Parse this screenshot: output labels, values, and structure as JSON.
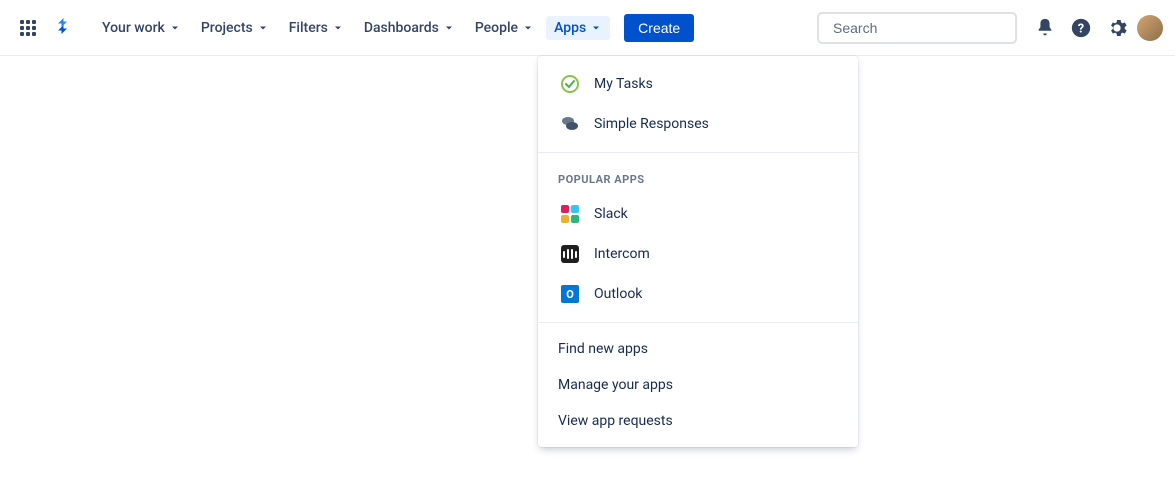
{
  "nav": {
    "items": [
      {
        "label": "Your work"
      },
      {
        "label": "Projects"
      },
      {
        "label": "Filters"
      },
      {
        "label": "Dashboards"
      },
      {
        "label": "People"
      },
      {
        "label": "Apps"
      }
    ],
    "create_label": "Create"
  },
  "search": {
    "placeholder": "Search"
  },
  "dropdown": {
    "your_apps": [
      {
        "label": "My Tasks",
        "icon": "mytasks"
      },
      {
        "label": "Simple Responses",
        "icon": "responses"
      }
    ],
    "popular_heading": "POPULAR APPS",
    "popular_apps": [
      {
        "label": "Slack",
        "icon": "slack"
      },
      {
        "label": "Intercom",
        "icon": "intercom"
      },
      {
        "label": "Outlook",
        "icon": "outlook"
      }
    ],
    "actions": [
      {
        "label": "Find new apps"
      },
      {
        "label": "Manage your apps"
      },
      {
        "label": "View app requests"
      }
    ]
  }
}
